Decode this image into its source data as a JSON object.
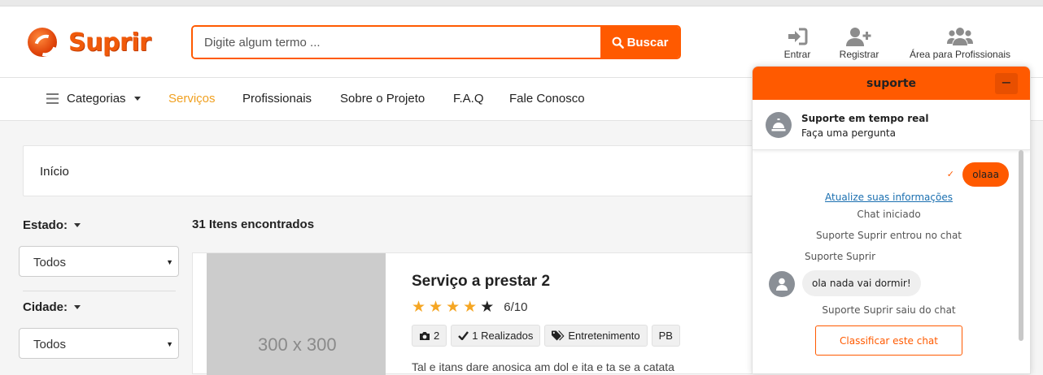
{
  "header": {
    "logo_text": "Suprir",
    "search_placeholder": "Digite algum termo ...",
    "search_button": "Buscar",
    "actions": [
      {
        "label": "Entrar",
        "icon": "sign-in-icon"
      },
      {
        "label": "Registrar",
        "icon": "user-plus-icon"
      },
      {
        "label": "Área para Profissionais",
        "icon": "users-icon"
      }
    ]
  },
  "nav": {
    "items": [
      "Categorias",
      "Serviços",
      "Profissionais",
      "Sobre o Projeto",
      "F.A.Q",
      "Fale Conosco"
    ],
    "active": "Serviços"
  },
  "breadcrumb": "Início",
  "filters": {
    "estado_label": "Estado:",
    "estado_value": "Todos",
    "cidade_label": "Cidade:",
    "cidade_value": "Todos"
  },
  "results": {
    "count_text": "31 Itens encontrados",
    "card": {
      "thumb_text": "300 x 300",
      "title": "Serviço a prestar 2",
      "stars_filled": 4,
      "stars_total": 5,
      "rating": "6/10",
      "photos": "2",
      "realizados": "1 Realizados",
      "category": "Entretenimento",
      "state": "PB",
      "desc": "Tal e itans dare anosica am dol e ita e ta se a catata"
    }
  },
  "chat": {
    "title": "suporte",
    "minimize": "−",
    "agent_title": "Suporte em tempo real",
    "agent_subtitle": "Faça uma pergunta",
    "my_message": "olaaa",
    "update_link": "Atualize suas informações",
    "sys_started": "Chat iniciado",
    "sys_joined": "Suporte Suprir entrou no chat",
    "agent_name": "Suporte Suprir",
    "agent_message": "ola nada vai dormir!",
    "sys_left": "Suporte Suprir saiu do chat",
    "rate_button": "Classificar este chat"
  },
  "colors": {
    "accent": "#ff5a00",
    "nav_active": "#f0a020",
    "star": "#f5a623",
    "link": "#1a6fb0"
  }
}
